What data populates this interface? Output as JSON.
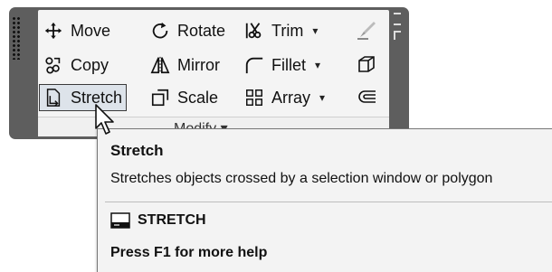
{
  "ribbon": {
    "panel_label": "Modify ▾",
    "tools": [
      {
        "label": "Move",
        "icon": "move-icon"
      },
      {
        "label": "Rotate",
        "icon": "rotate-icon"
      },
      {
        "label": "Trim",
        "icon": "trim-icon",
        "has_dropdown": true
      },
      {
        "label": "Copy",
        "icon": "copy-icon"
      },
      {
        "label": "Mirror",
        "icon": "mirror-icon"
      },
      {
        "label": "Fillet",
        "icon": "fillet-icon",
        "has_dropdown": true
      },
      {
        "label": "Stretch",
        "icon": "stretch-icon",
        "state": "hovered"
      },
      {
        "label": "Scale",
        "icon": "scale-icon"
      },
      {
        "label": "Array",
        "icon": "array-icon",
        "has_dropdown": true
      }
    ],
    "dropdown_caret": "▾"
  },
  "tooltip": {
    "title": "Stretch",
    "description": "Stretches objects crossed by a selection window or polygon",
    "command": "STRETCH",
    "help": "Press F1 for more help"
  }
}
